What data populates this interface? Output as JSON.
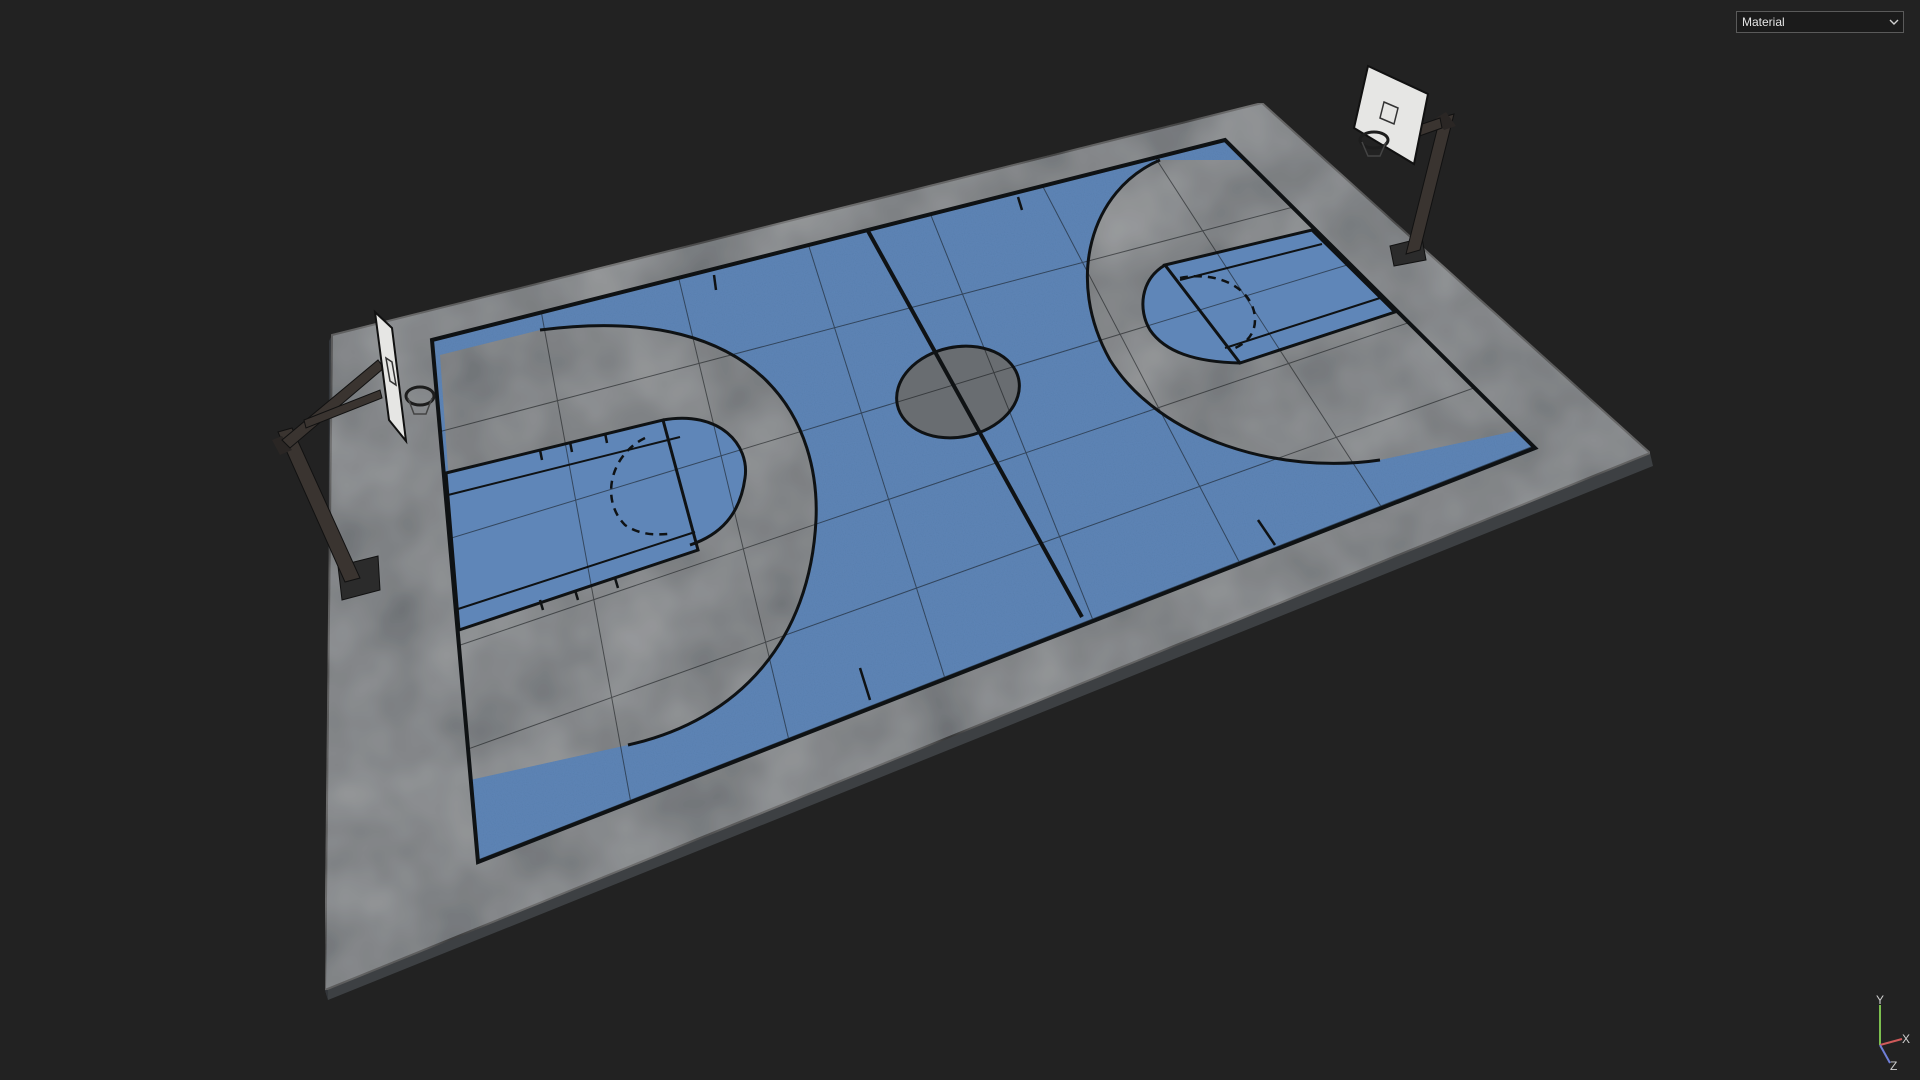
{
  "viewport": {
    "background_color": "#222222"
  },
  "shading_dropdown": {
    "selected": "Material",
    "icon": "chevron-down-icon"
  },
  "scene": {
    "object": "basketball-court",
    "court_blue": "#5f86b8",
    "concrete_gray": "#6a6e72",
    "line_color": "#0f1214"
  },
  "axis_gizmo": {
    "x_label": "X",
    "y_label": "Y",
    "z_label": "Z",
    "x_color": "#d05a5a",
    "y_color": "#7cbf4f",
    "z_color": "#6f7fd8"
  }
}
